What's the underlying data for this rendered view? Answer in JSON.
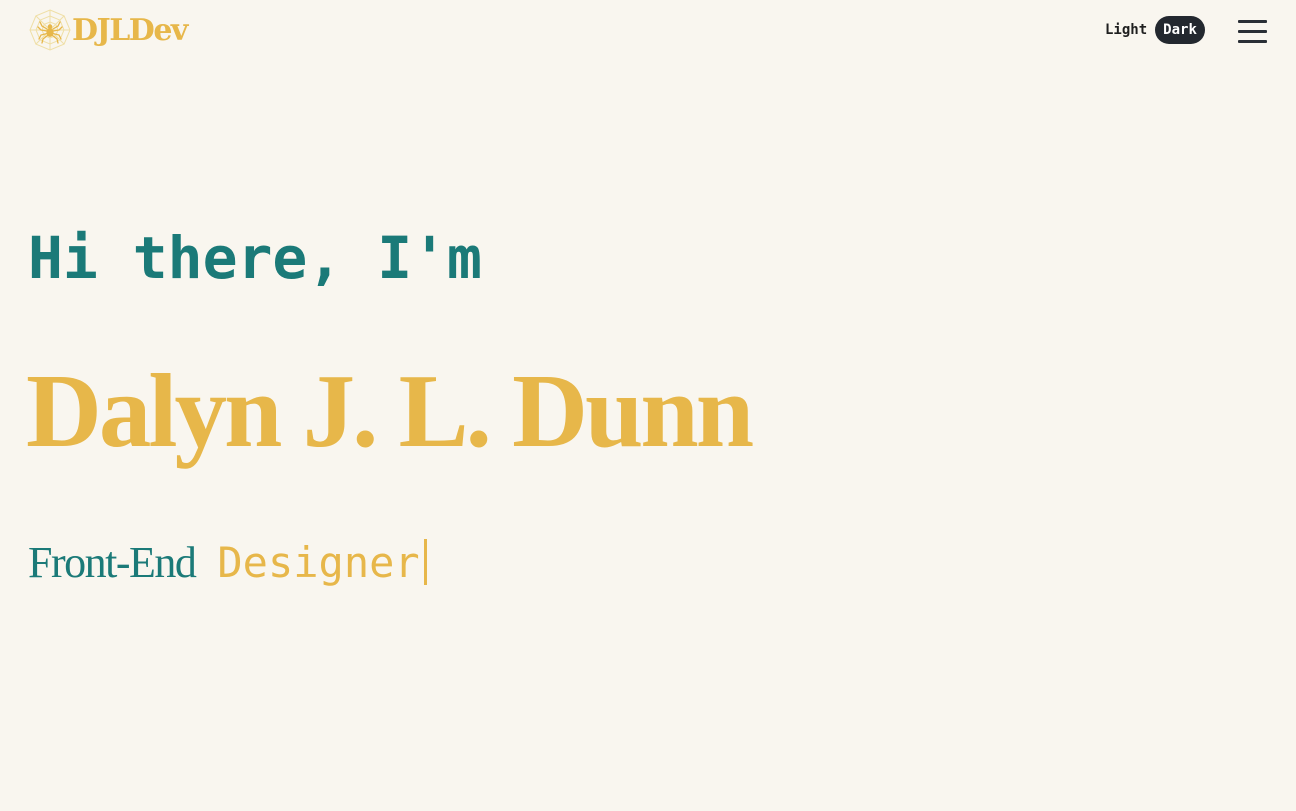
{
  "colors": {
    "background": "#f9f6ef",
    "accent_gold": "#e7b74a",
    "accent_teal": "#1b7a78",
    "dark": "#23282f"
  },
  "header": {
    "logo": {
      "icon": "spider-web-logo-icon",
      "text": "DJLDev"
    },
    "theme_toggle": {
      "light_label": "Light",
      "dark_label": "Dark",
      "selected": "Dark"
    },
    "menu_icon": "hamburger-menu-icon"
  },
  "hero": {
    "greeting": "Hi there, I'm",
    "name": "Dalyn J. L. Dunn",
    "role_prefix": "Front-End",
    "role_word": "Designer"
  }
}
